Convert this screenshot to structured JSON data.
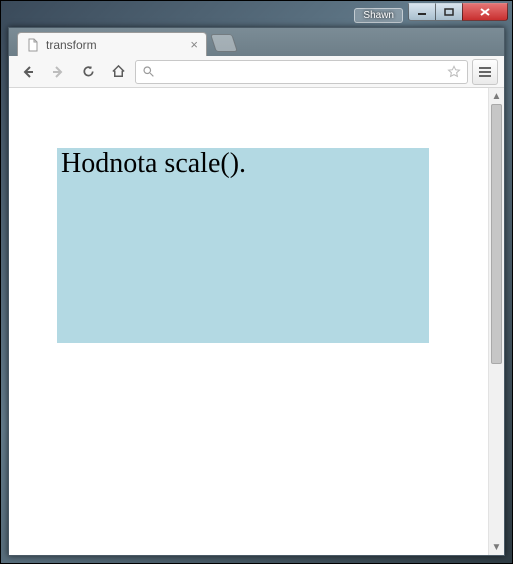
{
  "window": {
    "user_label": "Shawn"
  },
  "browser": {
    "tab_title": "transform",
    "address": "",
    "address_placeholder": ""
  },
  "page": {
    "demo_text": "Hodnota scale()."
  }
}
